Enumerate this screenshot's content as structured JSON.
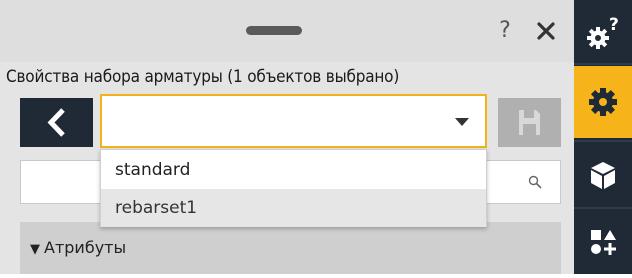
{
  "panel": {
    "title": "Свойства набора арматуры (1 объектов выбрано)",
    "help_label": "?",
    "attributes_label": "Атрибуты"
  },
  "select": {
    "current_value": "",
    "options": [
      "standard",
      "rebarset1"
    ],
    "highlighted_option": "rebarset1"
  },
  "search": {
    "value": "",
    "placeholder": ""
  },
  "toolbar": {
    "items": [
      "help-settings",
      "settings",
      "model",
      "add-shapes"
    ],
    "active": "settings"
  },
  "colors": {
    "accent": "#f6b31a",
    "toolbar_bg": "#1f2a36",
    "panel_bg": "#e4e4e4"
  }
}
